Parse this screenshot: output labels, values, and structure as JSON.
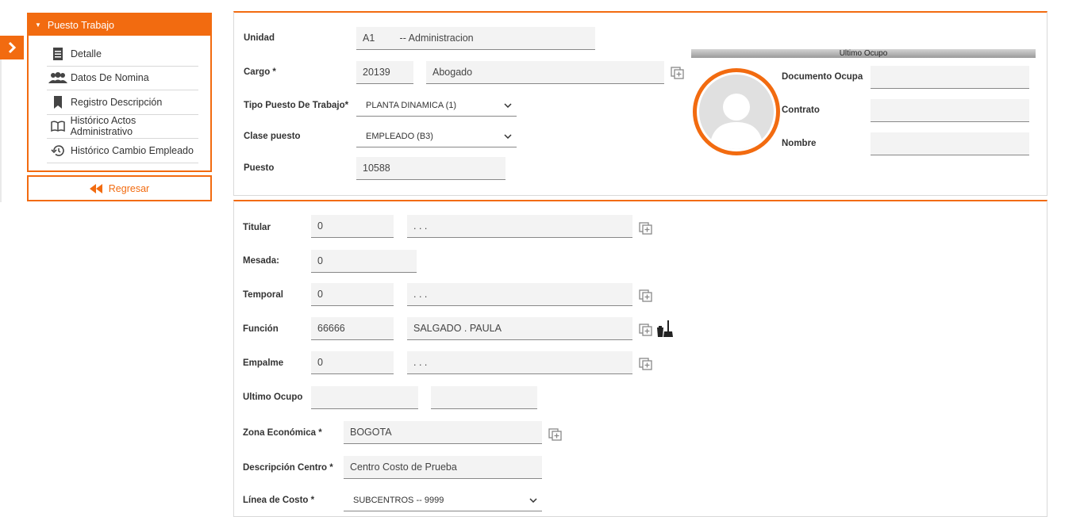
{
  "sidebar": {
    "header": "Puesto Trabajo",
    "items": [
      {
        "label": "Detalle",
        "icon": "document-icon"
      },
      {
        "label": "Datos De Nomina",
        "icon": "users-icon"
      },
      {
        "label": "Registro Descripción",
        "icon": "bookmark-icon"
      },
      {
        "label": "Histórico Actos Administrativo",
        "icon": "book-icon"
      },
      {
        "label": "Histórico Cambio Empleado",
        "icon": "history-icon"
      }
    ],
    "back_label": "Regresar"
  },
  "top": {
    "unidad": {
      "label": "Unidad",
      "value": "A1         -- Administracion"
    },
    "cargo": {
      "label": "Cargo *",
      "code": "20139",
      "name": "Abogado"
    },
    "tipo": {
      "label": "Tipo Puesto De Trabajo*",
      "value": "PLANTA DINAMICA (1)"
    },
    "clase": {
      "label": "Clase puesto",
      "value": "EMPLEADO (B3)"
    },
    "puesto": {
      "label": "Puesto",
      "value": "10588"
    },
    "ultimo": {
      "title": "Ultimo Ocupo",
      "documento_label": "Documento Ocupa",
      "documento_value": "",
      "contrato_label": "Contrato",
      "contrato_value": "",
      "nombre_label": "Nombre",
      "nombre_value": ""
    }
  },
  "bottom": {
    "titular": {
      "label": "Titular",
      "code": "0",
      "name": ". . ."
    },
    "mesada": {
      "label": "Mesada:",
      "value": "0"
    },
    "temporal": {
      "label": "Temporal",
      "code": "0",
      "name": ". . ."
    },
    "funcion": {
      "label": "Función",
      "code": "66666",
      "name": "SALGADO . PAULA"
    },
    "empalme": {
      "label": "Empalme",
      "code": "0",
      "name": ". . ."
    },
    "ultimo_ocupo": {
      "label": "Ultimo Ocupo",
      "code": "",
      "name": ""
    },
    "zona": {
      "label": "Zona Económica *",
      "value": "BOGOTA"
    },
    "descripcion": {
      "label": "Descripción Centro *",
      "value": "Centro Costo de Prueba"
    },
    "linea": {
      "label": "Línea de Costo *",
      "value": "SUBCENTROS -- 9999"
    }
  },
  "colors": {
    "accent": "#f26b10"
  }
}
